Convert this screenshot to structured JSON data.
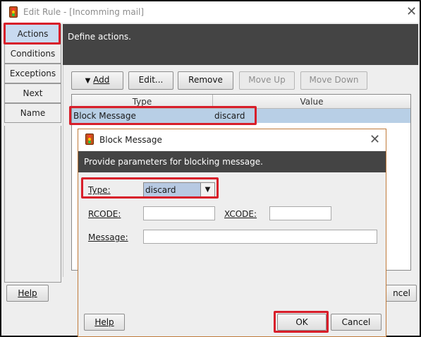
{
  "outer": {
    "title": "Edit Rule - [Incomming mail]",
    "tabs": [
      {
        "label": "Actions",
        "selected": true
      },
      {
        "label": "Conditions",
        "selected": false
      },
      {
        "label": "Exceptions",
        "selected": false
      },
      {
        "label": "Next",
        "selected": false
      },
      {
        "label": "Name",
        "selected": false
      }
    ],
    "header": "Define actions.",
    "toolbar": {
      "add_label": "Add",
      "edit_label": "Edit...",
      "remove_label": "Remove",
      "move_up_label": "Move Up",
      "move_down_label": "Move Down"
    },
    "table": {
      "columns": [
        "Type",
        "Value"
      ],
      "rows": [
        {
          "type": "Block Message",
          "value": "discard"
        }
      ]
    },
    "help_label": "Help",
    "cancel_partial_label": "ncel"
  },
  "dialog": {
    "title": "Block Message",
    "header": "Provide parameters for blocking message.",
    "type_label": "Type:",
    "type_value": "discard",
    "rcode_label": "RCODE:",
    "rcode_value": "",
    "xcode_label": "XCODE:",
    "xcode_value": "",
    "message_label": "Message:",
    "message_value": "",
    "help_label": "Help",
    "ok_label": "OK",
    "cancel_label": "Cancel"
  },
  "colors": {
    "highlight_red": "#d81e2a",
    "selection_blue": "#b8cfe6",
    "header_dark": "#444444"
  },
  "icons": [
    "traffic-light-icon",
    "close-icon",
    "dropdown-arrow-icon"
  ]
}
